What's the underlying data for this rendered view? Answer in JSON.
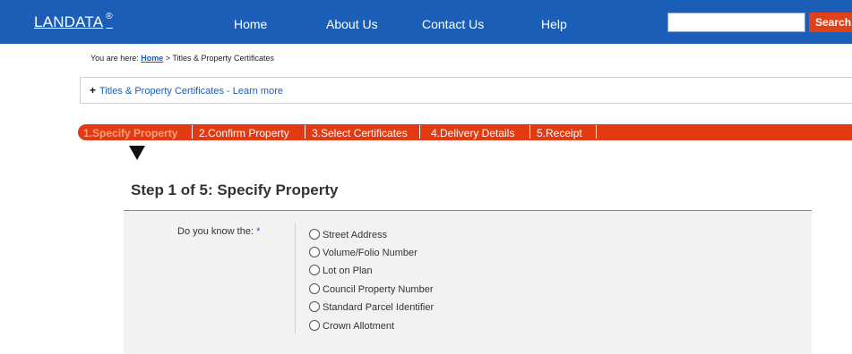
{
  "header": {
    "logo": "LANDATA",
    "logo_mark": "®",
    "nav": [
      "Home",
      "About Us",
      "Contact Us",
      "Help"
    ],
    "search_value": "",
    "search_button": "Search"
  },
  "breadcrumb": {
    "prefix": "You are here:",
    "home": "Home",
    "current": "> Titles & Property Certificates"
  },
  "learn_more": {
    "plus": "+",
    "text": "Titles & Property Certificates - Learn more"
  },
  "steps": [
    "1.Specify Property",
    "2.Confirm Property",
    "3.Select Certificates",
    "4.Delivery Details",
    "5.Receipt"
  ],
  "page": {
    "title": "Step 1 of 5: Specify Property"
  },
  "form": {
    "question": "Do you know the:",
    "required_mark": "*",
    "options": [
      "Street Address",
      "Volume/Folio Number",
      "Lot on Plan",
      "Council Property Number",
      "Standard Parcel Identifier",
      "Crown Allotment"
    ]
  },
  "colors": {
    "header_blue": "#1a5eb8",
    "steps_red": "#e23b14",
    "search_button": "#e0401a",
    "panel_bg": "#f2f2f2"
  }
}
